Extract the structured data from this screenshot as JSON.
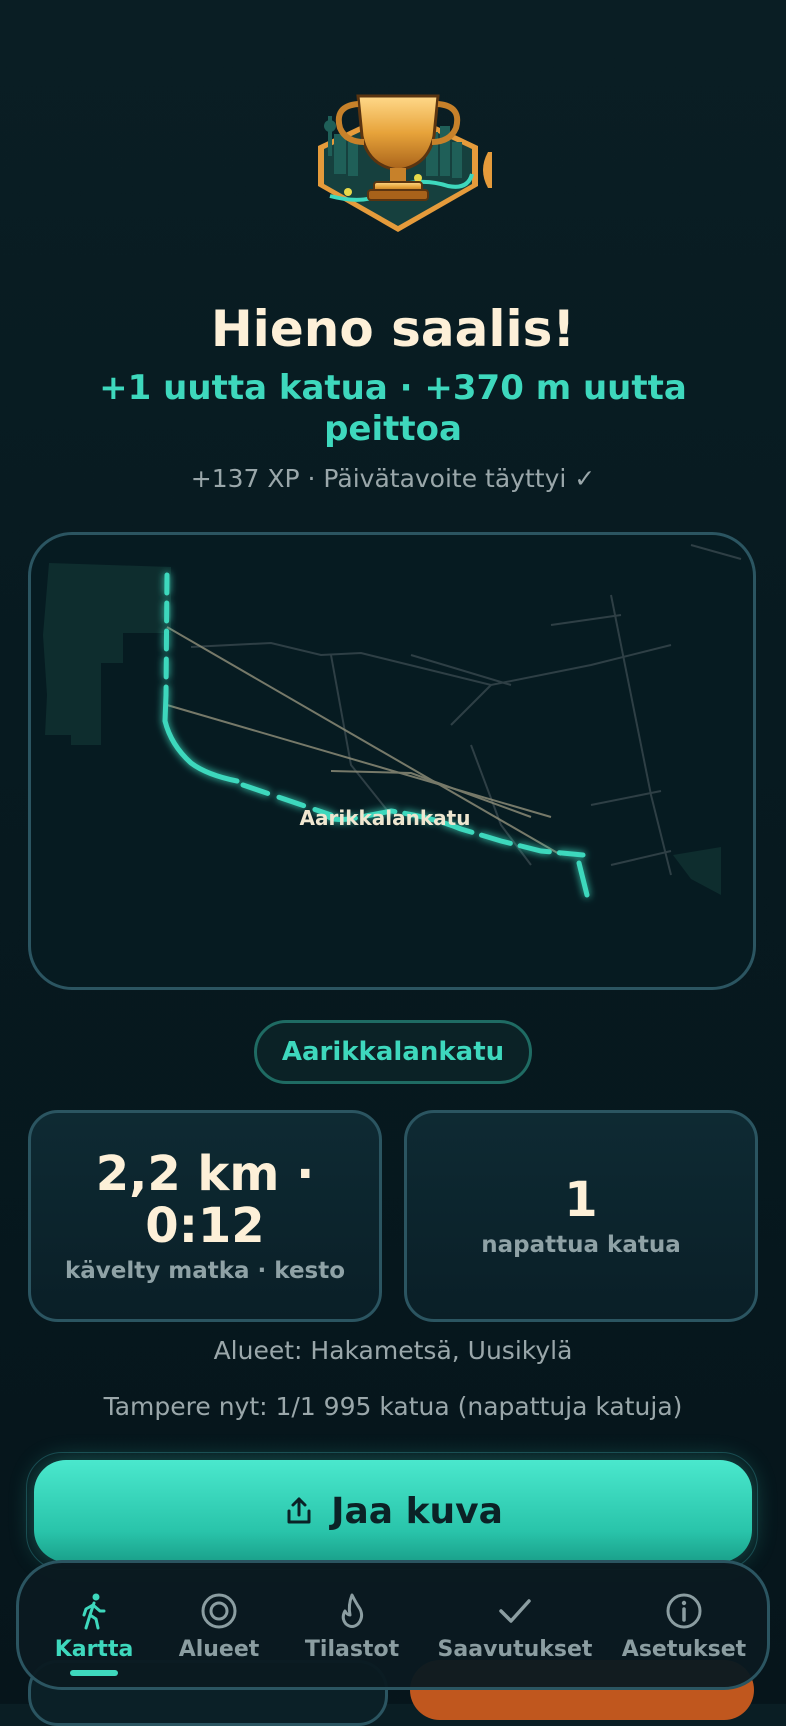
{
  "header": {
    "title": "Hieno saalis!",
    "subtitle": "+1 uutta katua · +370 m uutta peittoa",
    "xp_line": "+137 XP · Päivätavoite täyttyi ✓"
  },
  "badge": {
    "icon": "trophy-city-icon"
  },
  "map": {
    "street_label": "Aarikkalankatu"
  },
  "street_pill": "Aarikkalankatu",
  "stats": [
    {
      "value": "2,2 km · 0:12",
      "label": "kävelty matka · kesto"
    },
    {
      "value": "1",
      "label": "napattua katua"
    }
  ],
  "areas_line": "Alueet: Hakametsä, Uusikylä",
  "city_line": "Tampere nyt: 1/1 995 katua (napattuja katuja)",
  "share_button": {
    "label": "Jaa kuva",
    "icon": "share-icon"
  },
  "nav": {
    "items": [
      {
        "label": "Kartta",
        "icon": "walk-icon",
        "active": true
      },
      {
        "label": "Alueet",
        "icon": "target-icon",
        "active": false
      },
      {
        "label": "Tilastot",
        "icon": "flame-icon",
        "active": false
      },
      {
        "label": "Saavutukset",
        "icon": "check-icon",
        "active": false
      },
      {
        "label": "Asetukset",
        "icon": "info-icon",
        "active": false
      }
    ]
  },
  "colors": {
    "accent": "#3ed8bd",
    "title": "#fdf0d8",
    "muted": "#9aa7aa",
    "card_border": "#2b5561",
    "background": "#071a20"
  }
}
